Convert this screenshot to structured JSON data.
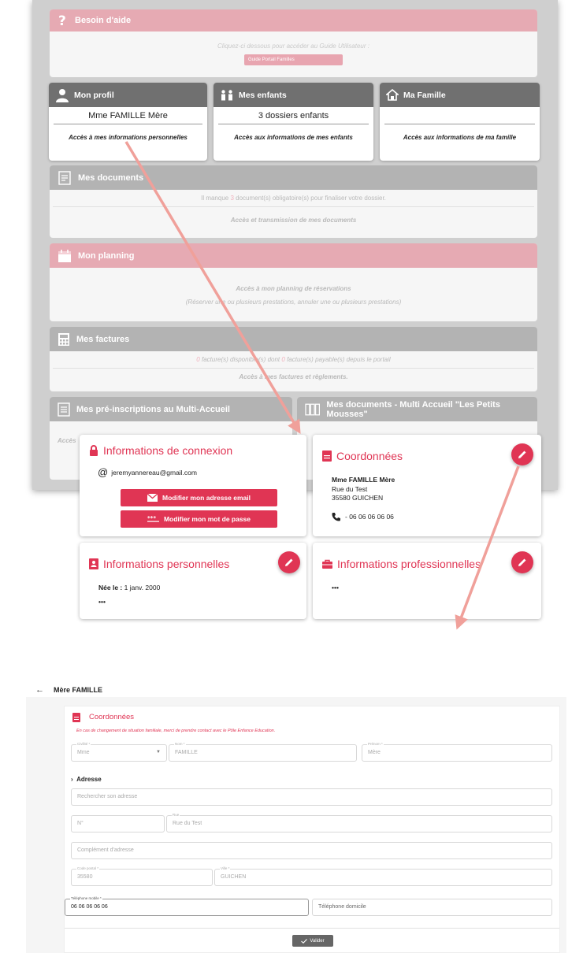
{
  "portal": {
    "help": {
      "title": "Besoin d'aide",
      "text": "Cliquez-ci dessous pour accéder au Guide Utilisateur :",
      "button": "Guide Portail Familles"
    },
    "cards": [
      {
        "title": "Mon profil",
        "value": "Mme FAMILLE Mère",
        "link": "Accès à mes informations personnelles",
        "icon": "user-icon"
      },
      {
        "title": "Mes enfants",
        "value": "3 dossiers enfants",
        "link": "Accès aux informations de mes enfants",
        "icon": "children-icon"
      },
      {
        "title": "Ma Famille",
        "value": "",
        "link": "Accès aux informations de ma famille",
        "icon": "house-icon"
      }
    ],
    "documents": {
      "title": "Mes documents",
      "info_pre": "Il manque",
      "info_count": "3",
      "info_post": "document(s) obligatoire(s) pour finaliser votre dossier.",
      "link": "Accès et transmission de mes documents"
    },
    "planning": {
      "title": "Mon planning",
      "link": "Accès à mon planning de réservations",
      "sub": "(Réserver une ou plusieurs prestations, annuler une ou plusieurs prestations)"
    },
    "factures": {
      "title": "Mes factures",
      "info_c1": "0",
      "info_mid": "facture(s) disponible(s) dont",
      "info_c2": "0",
      "info_post": "facture(s) payable(s) depuis le portail",
      "link": "Accès à mes factures et règlements."
    },
    "preinscriptions": {
      "title": "Mes pré-inscriptions au Multi-Accueil",
      "link": "Accès"
    },
    "multidocs": {
      "title": "Mes documents - Multi Accueil \"Les Petits Mousses\""
    }
  },
  "profile": {
    "connexion": {
      "title": "Informations de connexion",
      "email": "jeremyannereau@gmail.com",
      "btn_email": "Modifier mon adresse email",
      "btn_password": "Modifier mon mot de passe"
    },
    "coordonnees": {
      "title": "Coordonnées",
      "name": "Mme FAMILLE Mère",
      "street": "Rue du Test",
      "city": "35580 GUICHEN",
      "phone": "- 06 06 06 06 06"
    },
    "personnelles": {
      "title": "Informations personnelles",
      "birth_label": "Née le :",
      "birth_value": "1 janv. 2000",
      "more": "•••"
    },
    "professionnelles": {
      "title": "Informations professionnelles",
      "more": "•••"
    }
  },
  "form": {
    "page_title": "Mère FAMILLE",
    "section_title": "Coordonnées",
    "warning": "En cas de changement de situation familiale, merci de prendre contact avec le Pôle Enfance Education.",
    "civilite": {
      "label": "Civilité *",
      "value": "Mme"
    },
    "nom": {
      "label": "Nom *",
      "value": "FAMILLE"
    },
    "prenom": {
      "label": "Prénom *",
      "value": "Mère"
    },
    "adresse_title": "Adresse",
    "search_placeholder": "Rechercher son adresse",
    "numero_placeholder": "N°",
    "rue": {
      "label": "Rue",
      "value": "Rue du Test"
    },
    "complement_placeholder": "Complément d'adresse",
    "cp": {
      "label": "Code postal *",
      "value": "35580"
    },
    "ville": {
      "label": "Ville *",
      "value": "GUICHEN"
    },
    "tel_mobile": {
      "label": "Téléphone mobile *",
      "value": "06 06 06 06 06"
    },
    "tel_domicile_placeholder": "Téléphone domicile",
    "submit": "Valider"
  },
  "colors": {
    "accent": "#e03554",
    "portal_pink": "#e6aab3",
    "portal_grey": "#b3b3b3",
    "card_header": "#707070",
    "arrow": "#f0a09a"
  }
}
